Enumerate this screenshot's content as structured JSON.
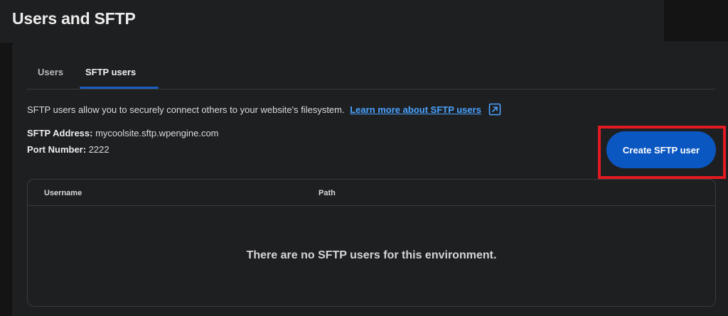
{
  "page": {
    "title": "Users and SFTP"
  },
  "tabs": [
    {
      "label": "Users",
      "active": false
    },
    {
      "label": "SFTP users",
      "active": true
    }
  ],
  "intro": {
    "text": "SFTP users allow you to securely connect others to your website's filesystem.",
    "link_label": "Learn more about SFTP users",
    "link_icon": "external-link-icon"
  },
  "info": {
    "address_label": "SFTP Address:",
    "address_value": "mycoolsite.sftp.wpengine.com",
    "port_label": "Port Number:",
    "port_value": "2222"
  },
  "actions": {
    "create_label": "Create SFTP user"
  },
  "table": {
    "columns": [
      "Username",
      "Path"
    ],
    "empty_message": "There are no SFTP users for this environment."
  },
  "colors": {
    "accent": "#0b57c2",
    "link": "#4aa3ff",
    "highlight": "#e11a22",
    "background": "#1e1f21"
  }
}
